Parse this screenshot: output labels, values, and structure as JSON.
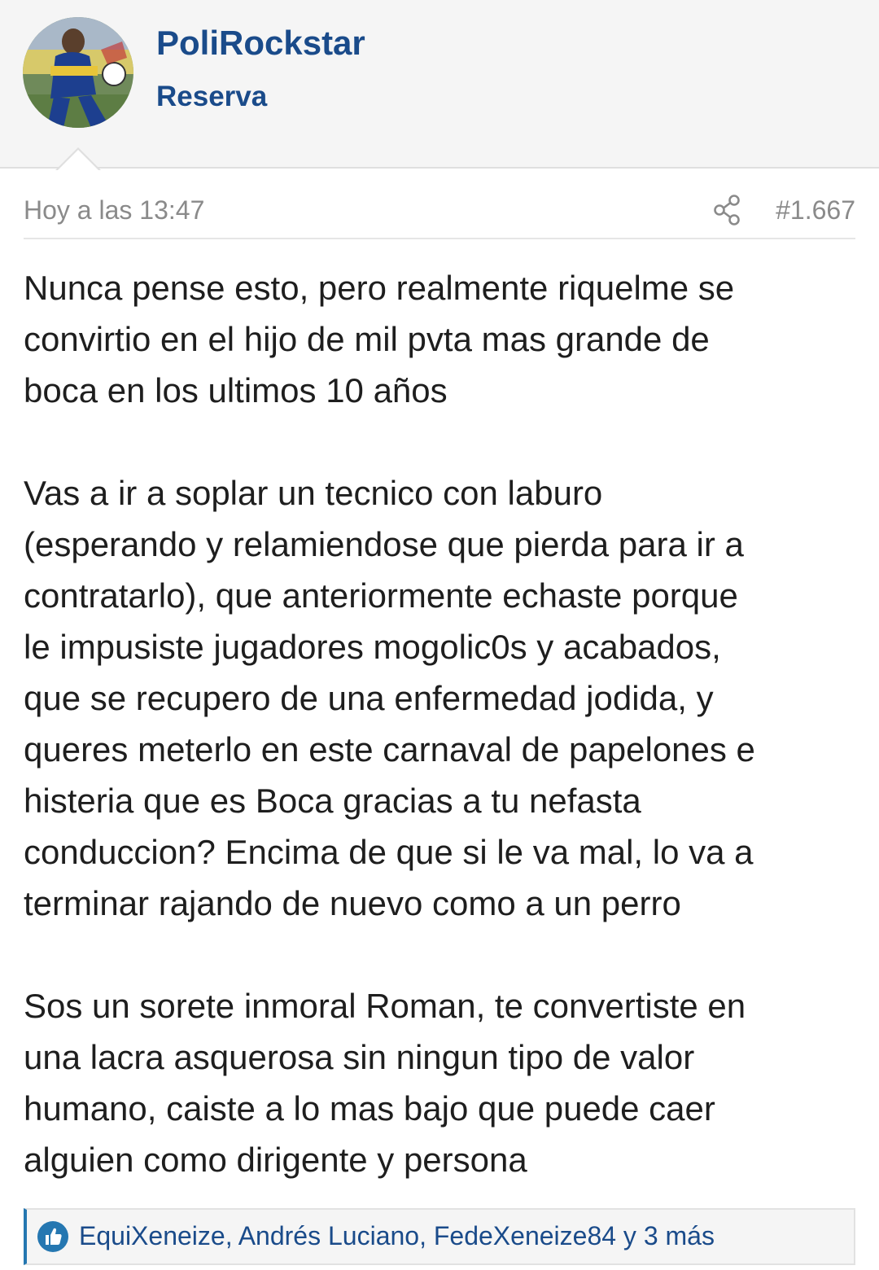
{
  "user": {
    "name": "PoliRockstar",
    "title": "Reserva",
    "avatar_icon": "avatar-photo"
  },
  "post": {
    "time": "Hoy a las 13:47",
    "number": "#1.667",
    "share_icon": "share-icon",
    "paragraphs": [
      {
        "lines": [
          "Nunca pense esto, pero realmente riquelme se",
          "convirtio en el hijo de mil pvta mas grande de",
          "boca en los ultimos 10 años"
        ]
      },
      {
        "lines": [
          "Vas a ir a soplar un tecnico con laburo",
          "(esperando y relamiendose que pierda para ir a",
          "contratarlo), que anteriormente echaste porque",
          "le impusiste jugadores mogolic0s y acabados,",
          "que se recupero de una enfermedad jodida, y",
          "queres meterlo en este carnaval de papelones e",
          "histeria que es Boca gracias a tu nefasta",
          "conduccion? Encima de que si le va mal, lo va a",
          "terminar rajando de nuevo como a un perro"
        ]
      },
      {
        "lines": [
          "Sos un sorete inmoral Roman, te convertiste en",
          "una lacra asquerosa sin ningun tipo de valor",
          "humano, caiste a lo mas bajo que puede caer",
          "alguien como dirigente y persona"
        ]
      }
    ]
  },
  "reactions": {
    "icon": "like-icon",
    "text": "EquiXeneize, Andrés Luciano, FedeXeneize84 y 3 más"
  },
  "colors": {
    "accent": "#1a4b8a",
    "like_blue": "#2577b1",
    "muted": "#8a8a8a",
    "header_bg": "#f5f5f5"
  }
}
